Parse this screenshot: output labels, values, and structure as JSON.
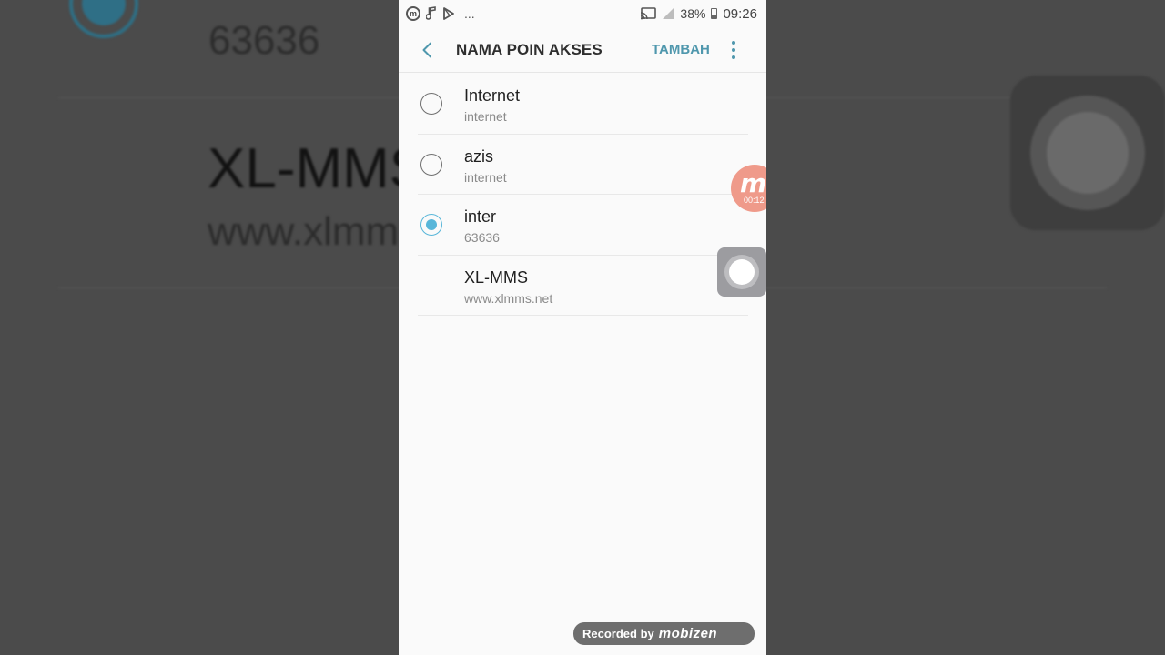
{
  "status_bar": {
    "left_icons": [
      "mobizen-icon",
      "music-note-icon",
      "play-store-icon"
    ],
    "more_notifications": "...",
    "right_icons": [
      "cast-icon",
      "signal-icon"
    ],
    "battery_percent": "38%",
    "time": "09:26"
  },
  "app_bar": {
    "title": "NAMA POIN AKSES",
    "add_label": "TAMBAH"
  },
  "apn_list": [
    {
      "name": "Internet",
      "apn": "internet",
      "radio": true,
      "selected": false
    },
    {
      "name": "azis",
      "apn": "internet",
      "radio": true,
      "selected": false
    },
    {
      "name": "inter",
      "apn": "63636",
      "radio": true,
      "selected": true
    },
    {
      "name": "XL-MMS",
      "apn": "www.xlmms.net",
      "radio": false,
      "selected": false
    }
  ],
  "background": {
    "top_value": "63636",
    "mid_title": "XL-MMS",
    "mid_sub": "www.xlmms.net"
  },
  "overlay": {
    "mobizen_letter": "m",
    "recording_timer": "00:12",
    "watermark_prefix": "Recorded by",
    "watermark_brand": "mobizen"
  },
  "colors": {
    "accent": "#4f97ad",
    "radio_selected": "#58b6d9",
    "mobizen_bubble": "#ef9a8a"
  }
}
